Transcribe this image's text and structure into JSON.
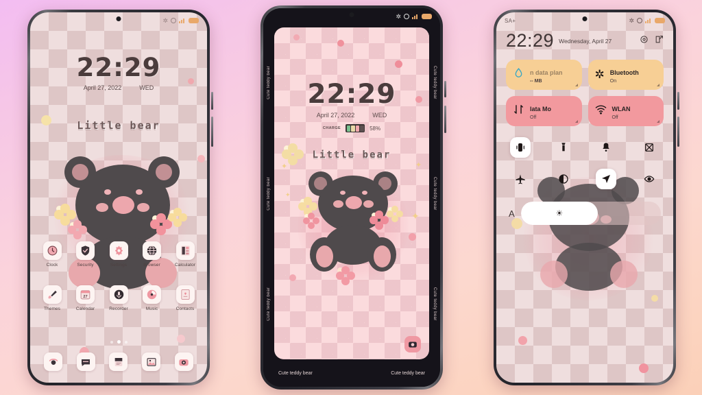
{
  "background": {
    "gradient_from": "#f3bdf2",
    "gradient_to": "#fbd0b8"
  },
  "theme": {
    "name": "Little bear",
    "side_text": "Cute teddy bear",
    "accent_pink": "#e8a8ac",
    "bear_body": "#4f4a4c",
    "tile_yellow": "#f7cf95",
    "tile_pink": "#f2999e"
  },
  "phone1": {
    "statusbar": {
      "bluetooth": "bluetooth-icon",
      "alarm": "alarm-icon",
      "signal": "signal-icon",
      "battery": "battery-icon"
    },
    "clock": {
      "time": "22:29",
      "date": "April 27, 2022",
      "weekday": "WED"
    },
    "wallpaper_text": "Little bear",
    "apps_row1": [
      {
        "label": "Clock",
        "icon": "clock-icon"
      },
      {
        "label": "Security",
        "icon": "shield-icon"
      },
      {
        "label": "Settings",
        "icon": "gear-icon"
      },
      {
        "label": "Browser",
        "icon": "globe-icon"
      },
      {
        "label": "Calculator",
        "icon": "calculator-icon"
      }
    ],
    "apps_row2": [
      {
        "label": "Themes",
        "icon": "brush-icon"
      },
      {
        "label": "Calendar",
        "icon": "calendar-icon"
      },
      {
        "label": "Recorder",
        "icon": "microphone-icon"
      },
      {
        "label": "Music",
        "icon": "music-icon"
      },
      {
        "label": "Contacts",
        "icon": "contacts-icon"
      }
    ],
    "page_dots": {
      "count": 3,
      "active_index": 1
    },
    "dock": [
      {
        "icon": "phone-icon"
      },
      {
        "icon": "messages-icon"
      },
      {
        "icon": "notes-icon"
      },
      {
        "icon": "gallery-icon"
      },
      {
        "icon": "camera-icon"
      }
    ]
  },
  "phone2": {
    "statusbar": {
      "bluetooth": "bluetooth-icon",
      "alarm": "alarm-icon",
      "signal": "signal-icon",
      "battery": "battery-icon"
    },
    "clock": {
      "time": "22:29",
      "date": "April 27, 2022",
      "weekday": "WED"
    },
    "charge": {
      "label": "CHARGE",
      "percent": "58%"
    },
    "wallpaper_text": "Little bear",
    "side_labels": [
      "Cute teddy bear",
      "Cute teddy bear",
      "Cute teddy bear",
      "Cute teddy bear"
    ],
    "bottom_left": "Cute teddy bear",
    "bottom_right": "Cute teddy bear",
    "shortcut_icon": "camera-icon"
  },
  "phone3": {
    "statusbar": {
      "carrier": "SA+",
      "bluetooth": "bluetooth-icon",
      "alarm": "alarm-icon",
      "signal": "signal-icon",
      "battery": "battery-icon"
    },
    "header": {
      "time": "22:29",
      "date": "Wednesday, April 27",
      "settings_icon": "gear-icon",
      "edit_icon": "edit-icon"
    },
    "tiles": [
      {
        "title": "n data plan",
        "sub": "-- MB",
        "icon": "data-drop-icon",
        "color": "#f7cf95"
      },
      {
        "title": "Bluetooth",
        "sub": "On",
        "icon": "bluetooth-icon",
        "color": "#f7cf95"
      },
      {
        "title": "lata      Mo",
        "sub": "Off",
        "icon": "data-transfer-icon",
        "color": "#f2999e"
      },
      {
        "title": "WLAN",
        "sub": "Off",
        "icon": "wifi-icon",
        "color": "#f2999e"
      }
    ],
    "toggles_row1": [
      {
        "icon": "vibrate-icon",
        "active": true
      },
      {
        "icon": "flashlight-icon",
        "active": false
      },
      {
        "icon": "bell-icon",
        "active": false
      },
      {
        "icon": "screenshot-icon",
        "active": false
      }
    ],
    "toggles_row2": [
      {
        "icon": "airplane-icon",
        "active": false
      },
      {
        "icon": "dark-mode-icon",
        "active": false
      },
      {
        "icon": "location-icon",
        "active": true
      },
      {
        "icon": "eye-protection-icon",
        "active": false
      }
    ],
    "brightness": {
      "auto_label": "A",
      "icon": "sun-icon",
      "value_percent": 55
    }
  }
}
